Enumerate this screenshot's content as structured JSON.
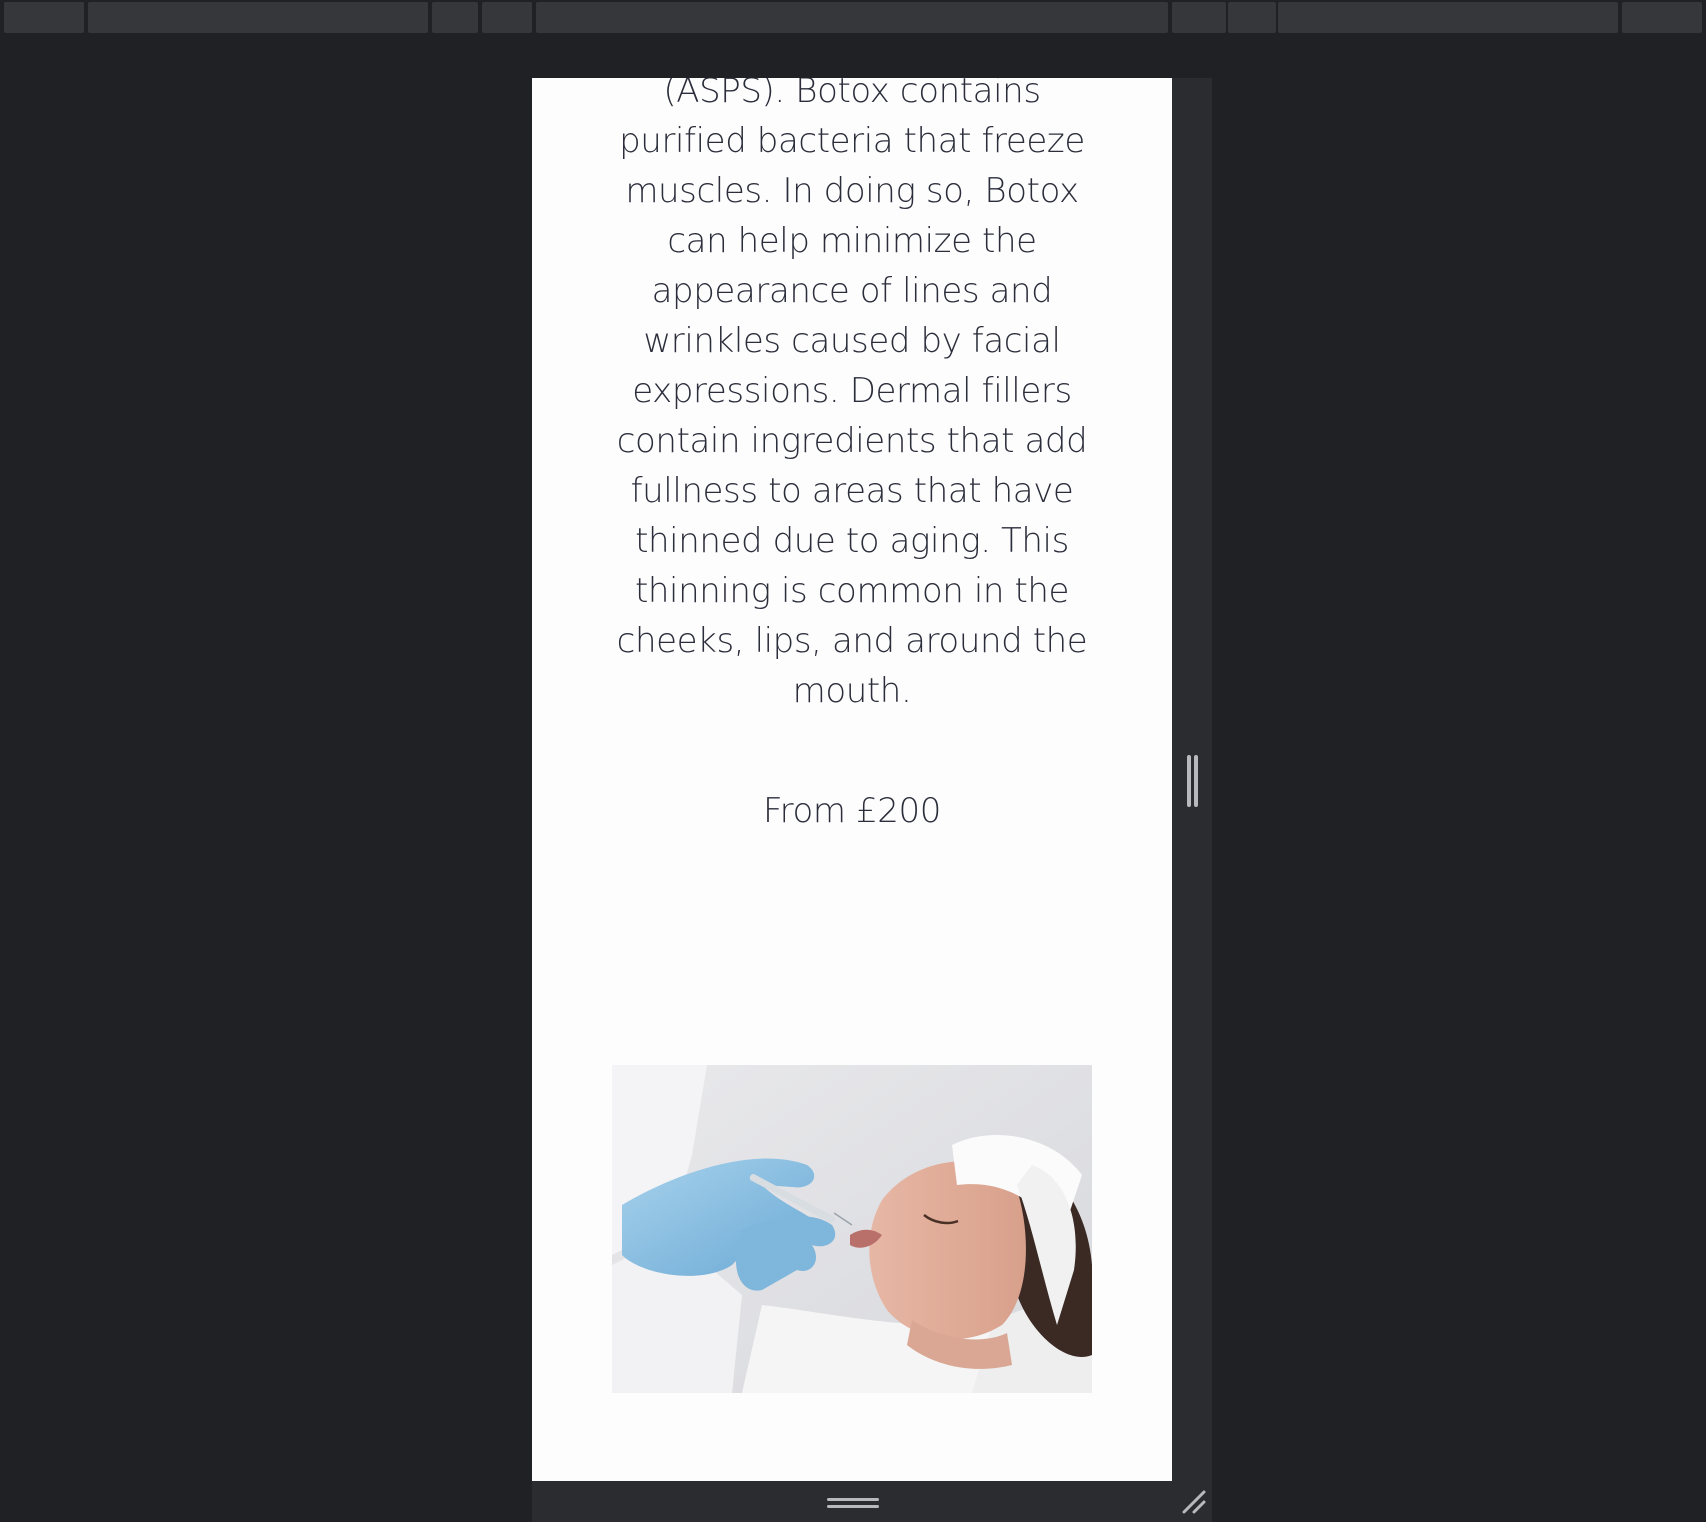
{
  "article": {
    "paragraph": "(ASPS). Botox contains purified bacteria that freeze muscles. In doing so, Botox can help minimize the appearance of lines and wrinkles caused by facial expressions. Dermal fillers contain ingredients that add fullness to areas that have thinned due to aging. This thinning is common in the cheeks, lips, and around the mouth.",
    "price": "From £200"
  },
  "colors": {
    "background": "#202124",
    "page": "#fdfdfd",
    "text": "#2b2d3b",
    "frame": "#2b2c30",
    "toolbar_segment": "#36373b",
    "handle": "#b8b9bd"
  },
  "icons": {
    "side_handle": "vertical-grip-icon",
    "bottom_handle": "horizontal-grip-icon",
    "corner": "resize-corner-icon"
  }
}
